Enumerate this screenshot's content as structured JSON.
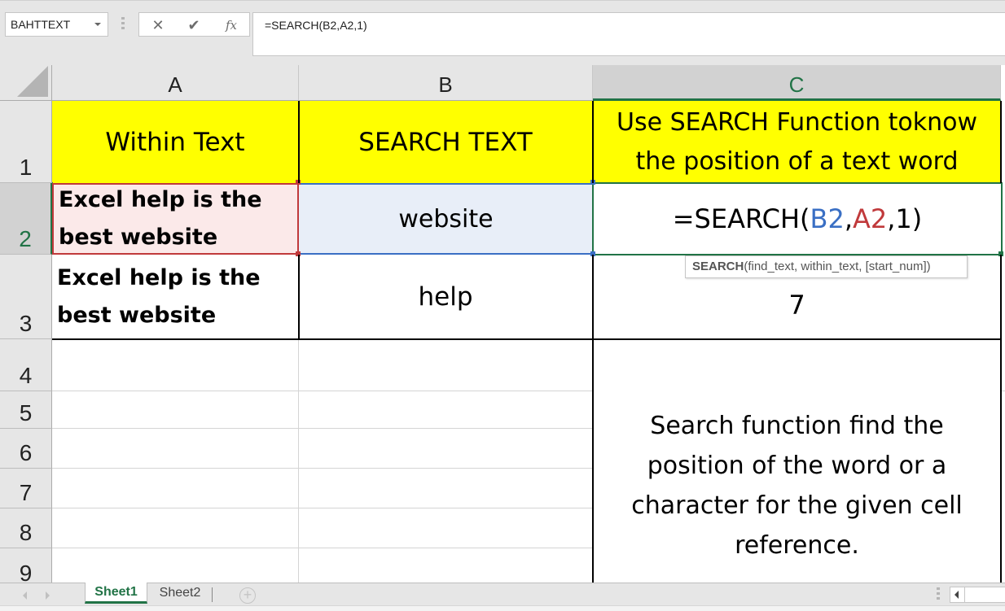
{
  "formula_bar": {
    "name_box": "BAHTTEXT",
    "cancel_icon": "✕",
    "enter_icon": "✔",
    "fx_label": "fx",
    "formula": "=SEARCH(B2,A2,1)"
  },
  "columns": [
    {
      "label": "A"
    },
    {
      "label": "B"
    },
    {
      "label": "C",
      "selected": true
    }
  ],
  "rows": [
    "1",
    "2",
    "3",
    "4",
    "5",
    "6",
    "7",
    "8",
    "9"
  ],
  "cells": {
    "A1": "Within Text",
    "B1": "SEARCH TEXT",
    "C1": "Use SEARCH Function toknow the position of a text word",
    "A2": "Excel help is the best website",
    "B2": "website",
    "C2": {
      "prefix": "=SEARCH(",
      "ref1": "B2",
      "sep1": ",",
      "ref2": "A2",
      "suffix": ",1)"
    },
    "A3": "Excel help is the best website",
    "B3": "help",
    "C3": "7",
    "C4_C9": "Search function find the position of the word or a character for the given cell reference."
  },
  "tooltip": {
    "function_name": "SEARCH",
    "args": "(find_text, within_text, [start_num])"
  },
  "sheet_tabs": [
    {
      "label": "Sheet1",
      "active": true
    },
    {
      "label": "Sheet2",
      "active": false
    }
  ],
  "add_sheet_icon": "+",
  "colors": {
    "header_fill": "#ffff00",
    "ref_b2_color": "#3a6fc4",
    "ref_a2_color": "#c0393b",
    "excel_green": "#217346",
    "a2_fill": "#fbe9e9",
    "b2_fill": "#e8eef8"
  }
}
